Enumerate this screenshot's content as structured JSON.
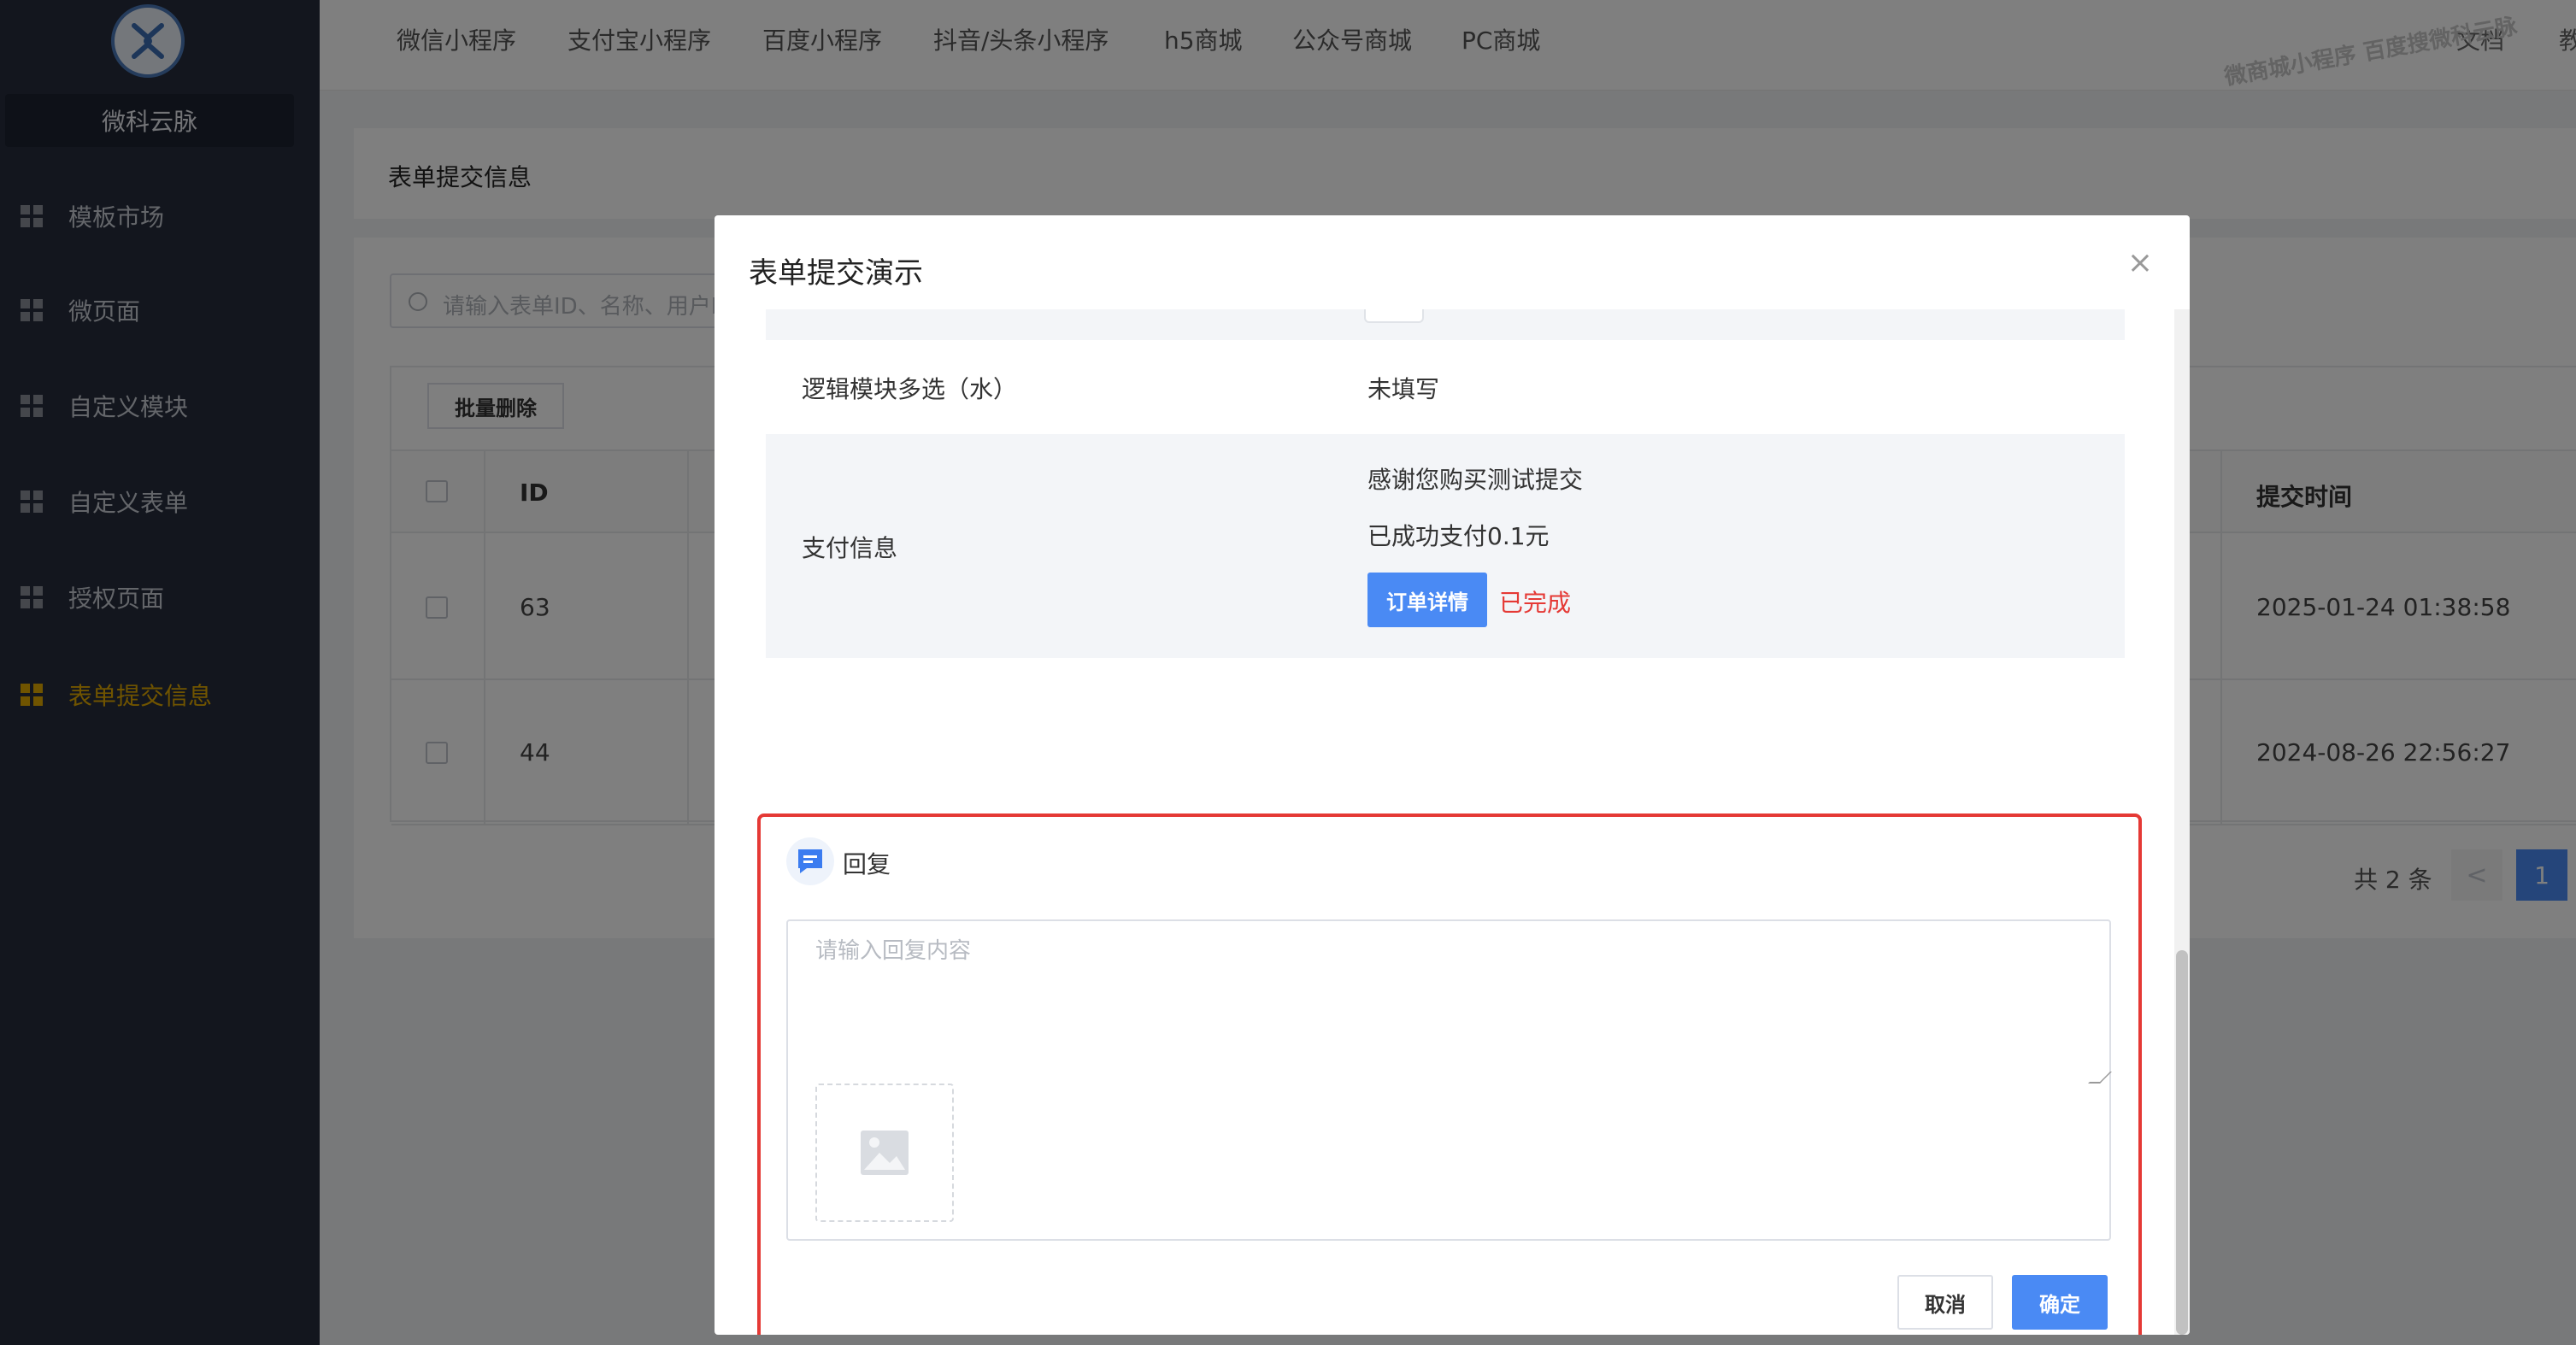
{
  "sidebar": {
    "brand": "微科云脉",
    "items": [
      {
        "label": "模板市场",
        "active": false
      },
      {
        "label": "微页面",
        "active": false
      },
      {
        "label": "自定义模块",
        "active": false
      },
      {
        "label": "自定义表单",
        "active": false
      },
      {
        "label": "授权页面",
        "active": false
      },
      {
        "label": "表单提交信息",
        "active": true
      }
    ]
  },
  "topbar": {
    "tabs": [
      "微信小程序",
      "支付宝小程序",
      "百度小程序",
      "抖音/头条小程序",
      "h5商城",
      "公众号商城",
      "PC商城"
    ],
    "right_text": "文档",
    "right_text_2": "教",
    "watermark": "微商城小程序 百度搜微科云脉"
  },
  "page": {
    "title": "表单提交信息",
    "search_placeholder": "请输入表单ID、名称、用户I",
    "batch_delete": "批量删除",
    "columns": {
      "id": "ID",
      "time": "提交时间"
    },
    "rows": [
      {
        "id": "63",
        "time": "2025-01-24 01:38:58"
      },
      {
        "id": "44",
        "time": "2024-08-26 22:56:27"
      }
    ],
    "pager": {
      "total": "共 2 条",
      "prev": "<",
      "current": "1"
    }
  },
  "modal": {
    "title": "表单提交演示",
    "close": "×",
    "fields": [
      {
        "key": "逻辑模块多选（水）",
        "value": "未填写"
      }
    ],
    "payment": {
      "key": "支付信息",
      "line1": "感谢您购买测试提交",
      "line2": "已成功支付0.1元",
      "order_button": "订单详情",
      "status": "已完成"
    },
    "reply": {
      "label": "回复",
      "placeholder": "请输入回复内容",
      "cancel": "取消",
      "confirm": "确定"
    }
  },
  "colors": {
    "sidebar_bg": "#262d3d",
    "accent": "#4a8af4",
    "active_nav": "#e0a800",
    "highlight_border": "#e53935",
    "status_done": "#e53935"
  }
}
